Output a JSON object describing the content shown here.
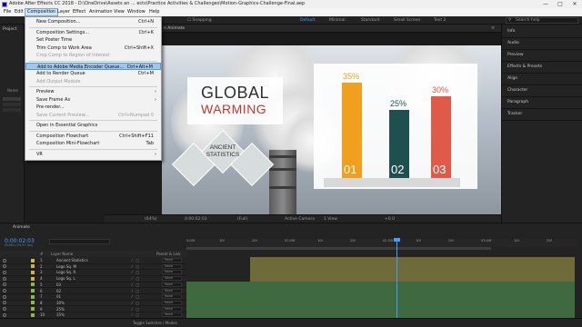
{
  "window": {
    "title": "Adobe After Effects CC 2018 - D:\\OneDrive\\Assets an ... ects\\Practice Activities & Challenges\\Motion-Graphics-Challenge-Final.aep",
    "minimize": "—",
    "maximize": "□",
    "close": "✕"
  },
  "menubar": [
    "File",
    "Edit",
    "Composition",
    "Layer",
    "Effect",
    "Animation",
    "View",
    "Window",
    "Help"
  ],
  "toolbar": {
    "snapping": "Snapping",
    "workspaces": [
      "Default",
      "Minimal",
      "Standard",
      "Small Screen",
      "Text 2"
    ],
    "search_placeholder": "Search help"
  },
  "left_panel": {
    "project_tab": "Project",
    "name_col": "Name"
  },
  "comp_tab": {
    "label": "n Animate",
    "menu": "≡"
  },
  "composition_menu": {
    "items": [
      {
        "label": "New Composition...",
        "shortcut": "Ctrl+N",
        "disabled": false,
        "highlighted": false,
        "submenu": false
      },
      {
        "sep": true
      },
      {
        "label": "Composition Settings...",
        "shortcut": "Ctrl+K",
        "disabled": false,
        "highlighted": false,
        "submenu": false
      },
      {
        "label": "Set Poster Time",
        "shortcut": "",
        "disabled": false,
        "highlighted": false,
        "submenu": false
      },
      {
        "label": "Trim Comp to Work Area",
        "shortcut": "Ctrl+Shift+X",
        "disabled": false,
        "highlighted": false,
        "submenu": false
      },
      {
        "label": "Crop Comp to Region of Interest",
        "shortcut": "",
        "disabled": true,
        "highlighted": false,
        "submenu": false
      },
      {
        "sep": true
      },
      {
        "label": "Add to Adobe Media Encoder Queue...",
        "shortcut": "Ctrl+Alt+M",
        "disabled": false,
        "highlighted": true,
        "submenu": false
      },
      {
        "label": "Add to Render Queue",
        "shortcut": "Ctrl+M",
        "disabled": false,
        "highlighted": false,
        "submenu": false
      },
      {
        "label": "Add Output Module",
        "shortcut": "",
        "disabled": true,
        "highlighted": false,
        "submenu": false
      },
      {
        "sep": true
      },
      {
        "label": "Preview",
        "shortcut": "",
        "disabled": false,
        "highlighted": false,
        "submenu": true
      },
      {
        "label": "Save Frame As",
        "shortcut": "",
        "disabled": false,
        "highlighted": false,
        "submenu": true
      },
      {
        "label": "Pre-render...",
        "shortcut": "",
        "disabled": false,
        "highlighted": false,
        "submenu": false
      },
      {
        "label": "Save Current Preview...",
        "shortcut": "Ctrl+Numpad 0",
        "disabled": true,
        "highlighted": false,
        "submenu": false
      },
      {
        "sep": true
      },
      {
        "label": "Open in Essential Graphics",
        "shortcut": "",
        "disabled": false,
        "highlighted": false,
        "submenu": false
      },
      {
        "sep": true
      },
      {
        "label": "Composition Flowchart",
        "shortcut": "Ctrl+Shift+F11",
        "disabled": false,
        "highlighted": false,
        "submenu": false
      },
      {
        "label": "Composition Mini-Flowchart",
        "shortcut": "Tab",
        "disabled": false,
        "highlighted": false,
        "submenu": false
      },
      {
        "sep": true
      },
      {
        "label": "VR",
        "shortcut": "",
        "disabled": false,
        "highlighted": false,
        "submenu": true
      }
    ]
  },
  "composition": {
    "global": "GLOBAL",
    "warming": "WARMING",
    "ancient_line1": "ANCIENT",
    "ancient_line2": "STATISTICS",
    "bars": [
      {
        "num": "01",
        "pct": "35%",
        "value": 35,
        "color": "#f0a01c"
      },
      {
        "num": "02",
        "pct": "25%",
        "value": 25,
        "color": "#1f4f4f"
      },
      {
        "num": "03",
        "pct": "30%",
        "value": 30,
        "color": "#e05a4a"
      }
    ]
  },
  "viewer_bar": {
    "zoom": "(64%)",
    "time": "0:00:02:03",
    "resolution": "(Full)",
    "camera": "Active Camera",
    "view": "1 View",
    "exposure": "+0.0"
  },
  "right_panels": [
    "Info",
    "Audio",
    "Preview",
    "Effects & Presets",
    "Align",
    "Character",
    "Paragraph",
    "Tracker"
  ],
  "timeline": {
    "tab": "Animate",
    "timecode": "0:00:02:03",
    "subframes": "00063 (29.97 fps)",
    "columns": {
      "num": "#",
      "name": "Layer Name",
      "parent": "Parent & Link"
    },
    "ruler": [
      "0:00f",
      "10f",
      "20f",
      "01:00f",
      "10f",
      "20f",
      "02:00f",
      "10f",
      "20f",
      "03:00f",
      "10f",
      "20f"
    ],
    "layers": [
      {
        "num": "1",
        "name": "Ancient Statistics",
        "label_color": "#c9b458",
        "parent": "None"
      },
      {
        "num": "2",
        "name": "Logo Sq. M",
        "label_color": "#c9b458",
        "parent": "None"
      },
      {
        "num": "3",
        "name": "Logo Sq. R",
        "label_color": "#c9b458",
        "parent": "None"
      },
      {
        "num": "4",
        "name": "Logo Sq. L",
        "label_color": "#c9b458",
        "parent": "None"
      },
      {
        "num": "5",
        "name": "03",
        "label_color": "#8fb84a",
        "parent": "None"
      },
      {
        "num": "6",
        "name": "02",
        "label_color": "#8fb84a",
        "parent": "None"
      },
      {
        "num": "7",
        "name": "01",
        "label_color": "#8fb84a",
        "parent": "None"
      },
      {
        "num": "8",
        "name": "30%",
        "label_color": "#8fb84a",
        "parent": "None"
      },
      {
        "num": "9",
        "name": "25%",
        "label_color": "#8fb84a",
        "parent": "None"
      },
      {
        "num": "10",
        "name": "35%",
        "label_color": "#8fb84a",
        "parent": "None"
      }
    ],
    "footer": {
      "toggle": "Toggle Switches / Modes"
    }
  },
  "colors": {
    "accent": "#4a9bff",
    "menu_highlight": "#9ec6ef"
  }
}
